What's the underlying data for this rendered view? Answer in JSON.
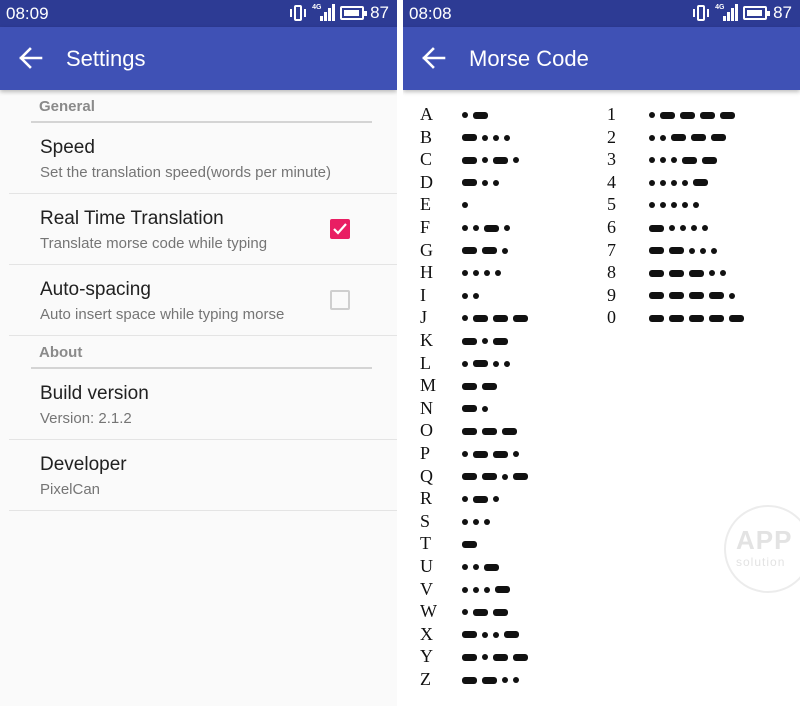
{
  "left": {
    "status": {
      "time": "08:09",
      "network": "4G",
      "battery": "87"
    },
    "app_bar": {
      "title": "Settings"
    },
    "sections": [
      {
        "header": "General",
        "items": [
          {
            "title": "Speed",
            "summary": "Set the translation speed(words per minute)"
          },
          {
            "title": "Real Time Translation",
            "summary": "Translate morse code while typing",
            "checkbox": true
          },
          {
            "title": "Auto-spacing",
            "summary": "Auto insert space while typing morse",
            "checkbox": false
          }
        ]
      },
      {
        "header": "About",
        "items": [
          {
            "title": "Build version",
            "summary": "Version: 2.1.2"
          },
          {
            "title": "Developer",
            "summary": "PixelCan"
          }
        ]
      }
    ]
  },
  "right": {
    "status": {
      "time": "08:08",
      "network": "4G",
      "battery": "87"
    },
    "app_bar": {
      "title": "Morse Code"
    },
    "letters": [
      {
        "char": "A",
        "code": ".-"
      },
      {
        "char": "B",
        "code": "-..."
      },
      {
        "char": "C",
        "code": "-.-."
      },
      {
        "char": "D",
        "code": "-.."
      },
      {
        "char": "E",
        "code": "."
      },
      {
        "char": "F",
        "code": "..-."
      },
      {
        "char": "G",
        "code": "--."
      },
      {
        "char": "H",
        "code": "...."
      },
      {
        "char": "I",
        "code": ".."
      },
      {
        "char": "J",
        "code": ".---"
      },
      {
        "char": "K",
        "code": "-.-"
      },
      {
        "char": "L",
        "code": ".-.."
      },
      {
        "char": "M",
        "code": "--"
      },
      {
        "char": "N",
        "code": "-."
      },
      {
        "char": "O",
        "code": "---"
      },
      {
        "char": "P",
        "code": ".--."
      },
      {
        "char": "Q",
        "code": "--.-"
      },
      {
        "char": "R",
        "code": ".-."
      },
      {
        "char": "S",
        "code": "..."
      },
      {
        "char": "T",
        "code": "-"
      },
      {
        "char": "U",
        "code": "..-"
      },
      {
        "char": "V",
        "code": "...-"
      },
      {
        "char": "W",
        "code": ".--"
      },
      {
        "char": "X",
        "code": "-..-"
      },
      {
        "char": "Y",
        "code": "-.--"
      },
      {
        "char": "Z",
        "code": "--.."
      }
    ],
    "digits": [
      {
        "char": "1",
        "code": ".----"
      },
      {
        "char": "2",
        "code": "..---"
      },
      {
        "char": "3",
        "code": "...--"
      },
      {
        "char": "4",
        "code": "....-"
      },
      {
        "char": "5",
        "code": "....."
      },
      {
        "char": "6",
        "code": "-...."
      },
      {
        "char": "7",
        "code": "--..."
      },
      {
        "char": "8",
        "code": "---.."
      },
      {
        "char": "9",
        "code": "----."
      },
      {
        "char": "0",
        "code": "-----"
      }
    ],
    "watermark": {
      "line1": "APP",
      "line2": "solution"
    }
  },
  "colors": {
    "status_bar": "#2d3b94",
    "app_bar": "#3f51b5",
    "accent": "#e91e63"
  },
  "icons": {
    "back": "arrow-left-icon",
    "vibrate": "vibrate-icon",
    "signal": "signal-icon",
    "battery": "battery-icon",
    "checkbox_checked": "checkbox-checked-icon",
    "checkbox_unchecked": "checkbox-unchecked-icon"
  }
}
